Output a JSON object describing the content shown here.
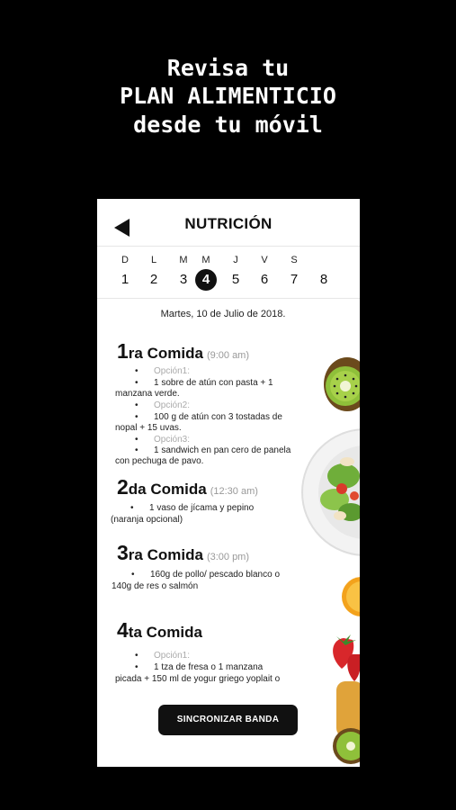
{
  "headline": {
    "line1": "Revisa tu",
    "line2": "PLAN ALIMENTICIO",
    "line3": "desde tu móvil"
  },
  "screen": {
    "title": "NUTRICIÓN",
    "back_icon": "back-arrow-icon"
  },
  "days": [
    {
      "letter": "D",
      "number": "1"
    },
    {
      "letter": "L",
      "number": "2"
    },
    {
      "letter": "M",
      "number": "3"
    },
    {
      "letter": "M",
      "number": "4",
      "selected": true
    },
    {
      "letter": "J",
      "number": "5"
    },
    {
      "letter": "V",
      "number": "6"
    },
    {
      "letter": "S",
      "number": "7"
    },
    {
      "letter": "",
      "number": "8"
    }
  ],
  "date": "Martes, 10 de Julio de 2018.",
  "meals": [
    {
      "num": "1",
      "title": "ra Comida",
      "time": "(9:00 am)",
      "items": [
        {
          "label": "Opción1:",
          "lines": [
            "1 sobre de atún con pasta + 1",
            "manzana verde."
          ]
        },
        {
          "label": "Opción2:",
          "lines": [
            "100 g de atún con 3 tostadas de",
            "nopal + 15 uvas."
          ]
        },
        {
          "label": "Opción3:",
          "lines": [
            "1 sandwich en pan cero de panela",
            "con pechuga de pavo."
          ]
        }
      ]
    },
    {
      "num": "2",
      "title": "da Comida",
      "time": "(12:30 am)",
      "items": [
        {
          "label": "",
          "lines": [
            "1 vaso de jícama y pepino",
            "(naranja opcional)"
          ]
        }
      ]
    },
    {
      "num": "3",
      "title": "ra Comida",
      "time": "(3:00 pm)",
      "items": [
        {
          "label": "",
          "lines": [
            "160g de pollo/ pescado blanco o",
            "140g de res o salmón"
          ]
        }
      ]
    },
    {
      "num": "4",
      "title": "ta Comida",
      "time": "",
      "items": [
        {
          "label": "Opción1:",
          "lines": [
            "1 tza de fresa o 1 manzana",
            "picada + 150 ml de yogur griego yoplait o"
          ]
        }
      ]
    }
  ],
  "sync_button": "SINCRONIZAR BANDA",
  "colors": {
    "background": "#000000",
    "panel": "#ffffff",
    "accent": "#111111",
    "muted": "#999999"
  }
}
